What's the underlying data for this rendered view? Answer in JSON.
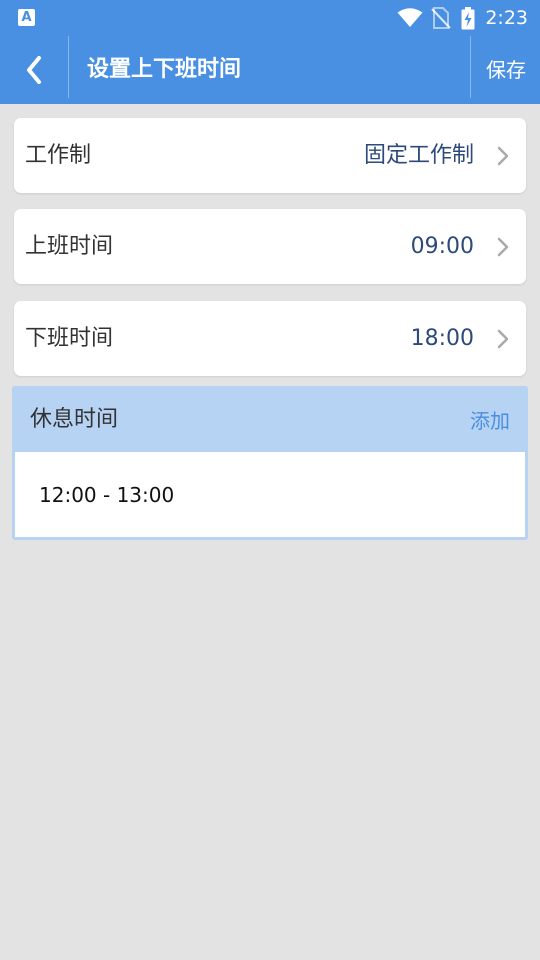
{
  "status_bar": {
    "app_icon_letter": "A",
    "time": "2:23",
    "icons": [
      "wifi-icon",
      "no-sim-icon",
      "battery-charging-icon"
    ]
  },
  "app_bar": {
    "back_icon": "chevron-left-icon",
    "title": "设置上下班时间",
    "save_label": "保存"
  },
  "settings": [
    {
      "label": "工作制",
      "value": "固定工作制"
    },
    {
      "label": "上班时间",
      "value": "09:00"
    },
    {
      "label": "下班时间",
      "value": "18:00"
    }
  ],
  "break_section": {
    "label": "休息时间",
    "add_label": "添加",
    "items": [
      "12:00 - 13:00"
    ]
  },
  "colors": {
    "primary": "#4a90e2",
    "background": "#e3e3e3",
    "section_header": "#b7d3f3",
    "value_text": "#2d4a7a",
    "link": "#4a8ee0"
  }
}
